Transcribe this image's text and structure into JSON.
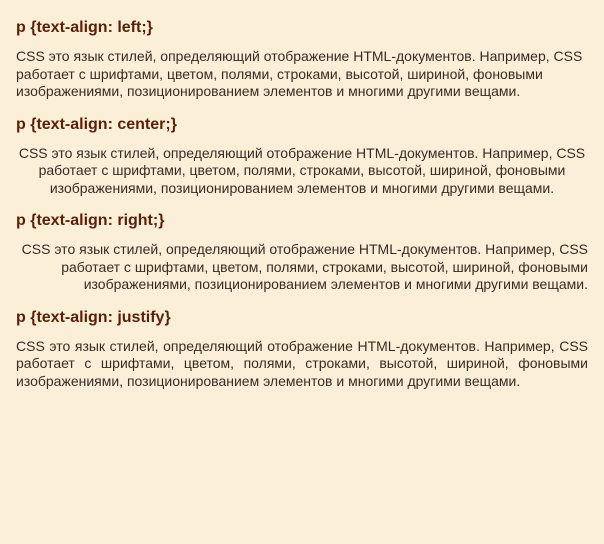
{
  "sections": [
    {
      "heading": "p {text-align: left;}",
      "align": "left",
      "text": "CSS это язык стилей, определяющий отображение HTML-документов. Например, CSS работает с шрифтами, цветом, полями, строками, высотой, шириной, фоновыми изображениями, позиционированием элементов и многими другими вещами."
    },
    {
      "heading": "p {text-align: center;}",
      "align": "center",
      "text": "CSS это язык стилей, определяющий отображение HTML-документов. Например, CSS работает с шрифтами, цветом, полями, строками, высотой, шириной, фоновыми изображениями, позиционированием элементов и многими другими вещами."
    },
    {
      "heading": "p {text-align: right;}",
      "align": "right",
      "text": "CSS это язык стилей, определяющий отображение HTML-документов. Например, CSS работает с шрифтами, цветом, полями, строками, высотой, шириной, фоновыми изображениями, позиционированием элементов и многими другими вещами."
    },
    {
      "heading": "p {text-align: justify}",
      "align": "justify",
      "text": "CSS это язык стилей, определяющий отображение HTML-документов. Например, CSS работает с шрифтами, цветом, полями, строками, высотой, шириной, фоновыми изображениями, позиционированием элементов и многими другими вещами."
    }
  ]
}
